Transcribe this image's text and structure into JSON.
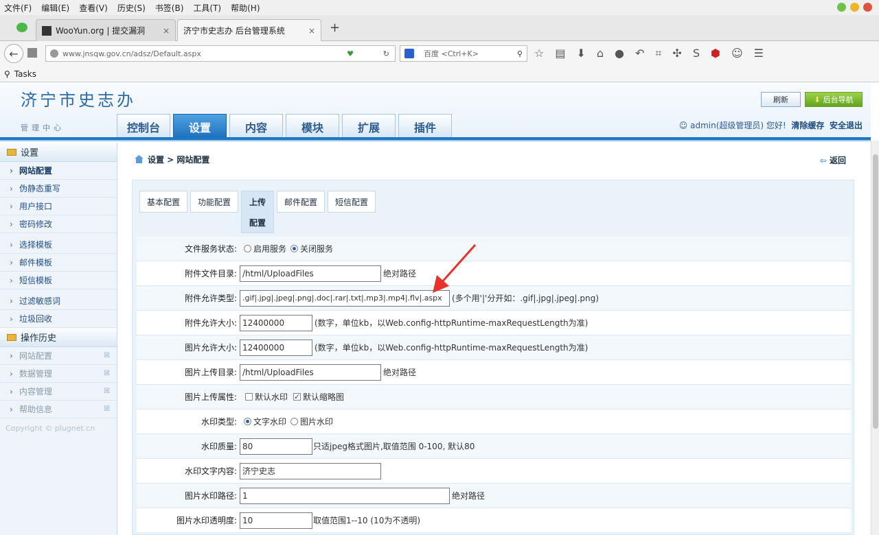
{
  "browser": {
    "menu": [
      "文件(F)",
      "编辑(E)",
      "查看(V)",
      "历史(S)",
      "书签(B)",
      "工具(T)",
      "帮助(H)"
    ],
    "tabs": [
      {
        "label": "WooYun.org | 提交漏洞"
      },
      {
        "label": "济宁市史志办 后台管理系统"
      }
    ],
    "url": "www.jnsqw.gov.cn/adsz/Default.aspx",
    "search_placeholder": "百度 <Ctrl+K>",
    "bookmarks_label": "Tasks"
  },
  "header": {
    "site_title": "济宁市史志办",
    "subtitle": "管理中心",
    "refresh_label": "刷新",
    "nav_label": "后台导航",
    "main_tabs": [
      "控制台",
      "设置",
      "内容",
      "模块",
      "扩展",
      "插件"
    ],
    "user_text": "admin(超级管理员) 您好!",
    "clear_cache": "清除缓存",
    "logout": "安全退出"
  },
  "sidebar": {
    "group1": "设置",
    "items1": [
      "网站配置",
      "伪静态重写",
      "用户接口",
      "密码修改"
    ],
    "items2": [
      "选择模板",
      "邮件模板",
      "短信模板"
    ],
    "items3": [
      "过滤敏感词",
      "垃圾回收"
    ],
    "group2": "操作历史",
    "history": [
      "网站配置",
      "数据管理",
      "内容管理",
      "帮助信息"
    ],
    "copyright": "Copyright © plugnet.cn"
  },
  "content": {
    "breadcrumb": "设置 > 网站配置",
    "back_label": "返回",
    "subtabs": [
      "基本配置",
      "功能配置",
      "上传",
      "配置",
      "邮件配置",
      "短信配置"
    ],
    "form": {
      "file_service_label": "文件服务状态:",
      "file_service_on": "启用服务",
      "file_service_off": "关闭服务",
      "attach_dir_label": "附件文件目录:",
      "attach_dir_value": "/html/UploadFiles",
      "attach_dir_note": "绝对路径",
      "attach_types_label": "附件允许类型:",
      "attach_types_value": ".gif|.jpg|.jpeg|.png|.doc|.rar|.txt|.mp3|.mp4|.flv|.aspx",
      "attach_types_note": "(多个用'|'分开如：.gif|.jpg|.jpeg|.png)",
      "attach_size_label": "附件允许大小:",
      "attach_size_value": "12400000",
      "size_note": "(数字，单位kb，以Web.config-httpRuntime-maxRequestLength为准)",
      "img_size_label": "图片允许大小:",
      "img_size_value": "12400000",
      "img_dir_label": "图片上传目录:",
      "img_dir_value": "/html/UploadFiles",
      "img_dir_note": "绝对路径",
      "img_attr_label": "图片上传属性:",
      "img_attr_wm": "默认水印",
      "img_attr_thumb": "默认缩略图",
      "wm_type_label": "水印类型:",
      "wm_type_text": "文字水印",
      "wm_type_img": "图片水印",
      "wm_quality_label": "水印质量:",
      "wm_quality_value": "80",
      "wm_quality_note": "只适jpeg格式图片,取值范围 0-100, 默认80",
      "wm_text_label": "水印文字内容:",
      "wm_text_value": "济宁史志",
      "wm_path_label": "图片水印路径:",
      "wm_path_value": "1",
      "wm_path_note": "绝对路径",
      "wm_opacity_label": "图片水印透明度:",
      "wm_opacity_value": "10",
      "wm_opacity_note": "取值范围1--10 (10为不透明)"
    }
  },
  "colors": {
    "accent": "#1d78c4",
    "annotation_arrow": "#e8322c"
  }
}
